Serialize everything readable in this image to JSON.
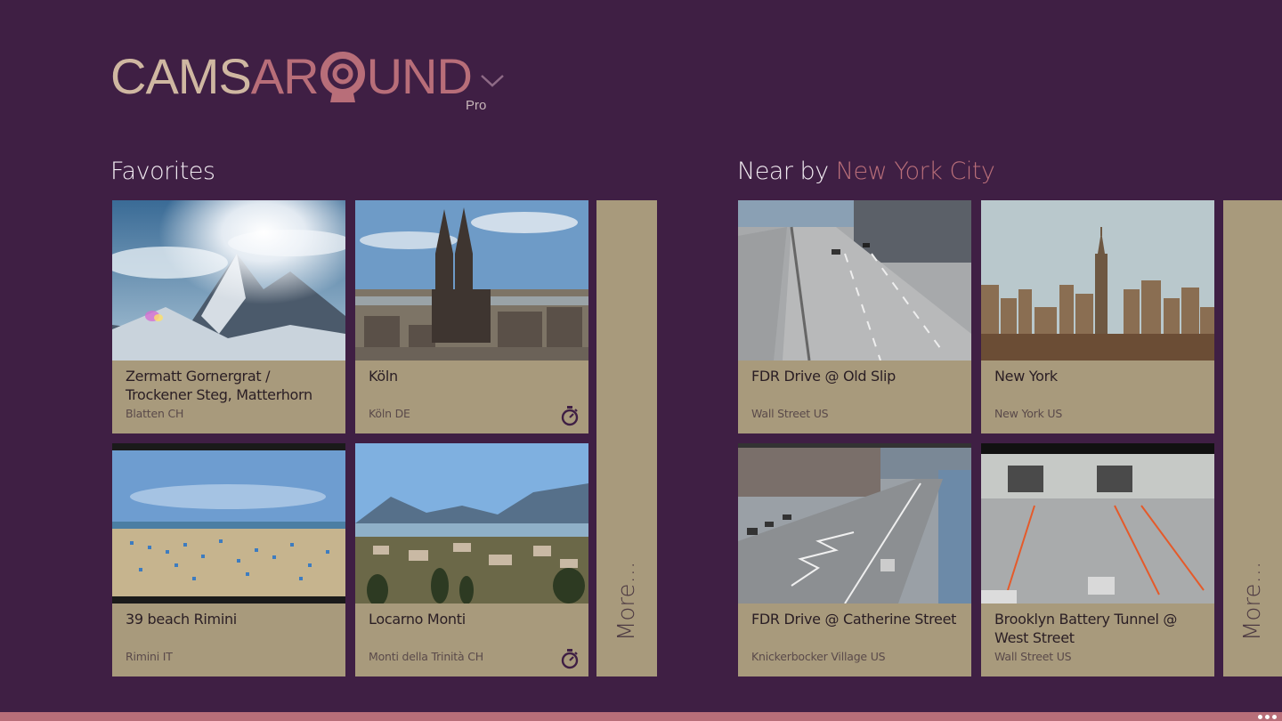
{
  "app": {
    "logo_text_a": "CAMS",
    "logo_text_b_left": "AR",
    "logo_text_b_right": "UND",
    "edition": "Pro"
  },
  "favorites": {
    "title": "Favorites",
    "more_label": "More...",
    "tiles": [
      {
        "title": "Zermatt Gornergrat / Trockener Steg, Matterhorn",
        "location": "Blatten CH",
        "timer": false,
        "thumb": "mountain-snow"
      },
      {
        "title": "Köln",
        "location": "Köln DE",
        "timer": true,
        "thumb": "cathedral-city"
      },
      {
        "title": "39 beach Rimini",
        "location": "Rimini IT",
        "timer": false,
        "thumb": "beach-umbrellas"
      },
      {
        "title": "Locarno Monti",
        "location": "Monti della Trinità CH",
        "timer": true,
        "thumb": "lake-town"
      }
    ]
  },
  "nearby": {
    "title_prefix": "Near by ",
    "city": "New York City",
    "more_label": "More...",
    "tiles": [
      {
        "title": "FDR Drive @ Old Slip",
        "location": "Wall Street US",
        "thumb": "highway"
      },
      {
        "title": "New York",
        "location": "New York US",
        "thumb": "skyline"
      },
      {
        "title": "FDR Drive @ Catherine Street",
        "location": "Knickerbocker Village US",
        "thumb": "highway-river"
      },
      {
        "title": "Brooklyn Battery Tunnel @ West Street",
        "location": "Wall Street US",
        "thumb": "tunnel"
      }
    ]
  },
  "colors": {
    "background": "#3f1f44",
    "accent": "#b86e79",
    "tile": "#a89a7c",
    "logo_light": "#cfb7a1"
  },
  "icons": {
    "timer": "stopwatch-icon",
    "app_bar_more": "ellipsis-icon",
    "logo_dropdown": "chevron-down-icon"
  }
}
